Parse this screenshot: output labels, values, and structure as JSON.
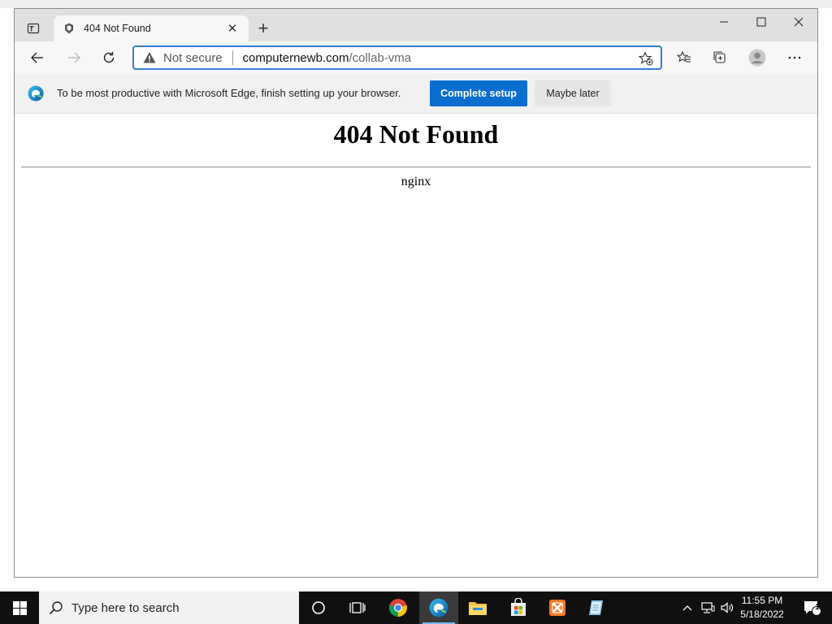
{
  "browser": {
    "tab": {
      "title": "404 Not Found"
    },
    "address_bar": {
      "security_label": "Not secure",
      "url_host": "computernewb.com",
      "url_path": "/collab-vma"
    },
    "infobar": {
      "message": "To be most productive with Microsoft Edge, finish setting up your browser.",
      "primary_button": "Complete setup",
      "secondary_button": "Maybe later"
    }
  },
  "page": {
    "heading": "404 Not Found",
    "server": "nginx"
  },
  "taskbar": {
    "search_placeholder": "Type here to search",
    "apps": [
      "task-view-icon",
      "chrome-icon",
      "edge-icon",
      "file-explorer-icon",
      "store-icon",
      "xampp-icon",
      "notepad-icon"
    ],
    "clock_time": "11:55 PM",
    "clock_date": "5/18/2022",
    "notification_count": "1"
  },
  "colors": {
    "accent": "#0a6ecf",
    "address_focus": "#3a7bd5",
    "taskbar": "#101010"
  }
}
